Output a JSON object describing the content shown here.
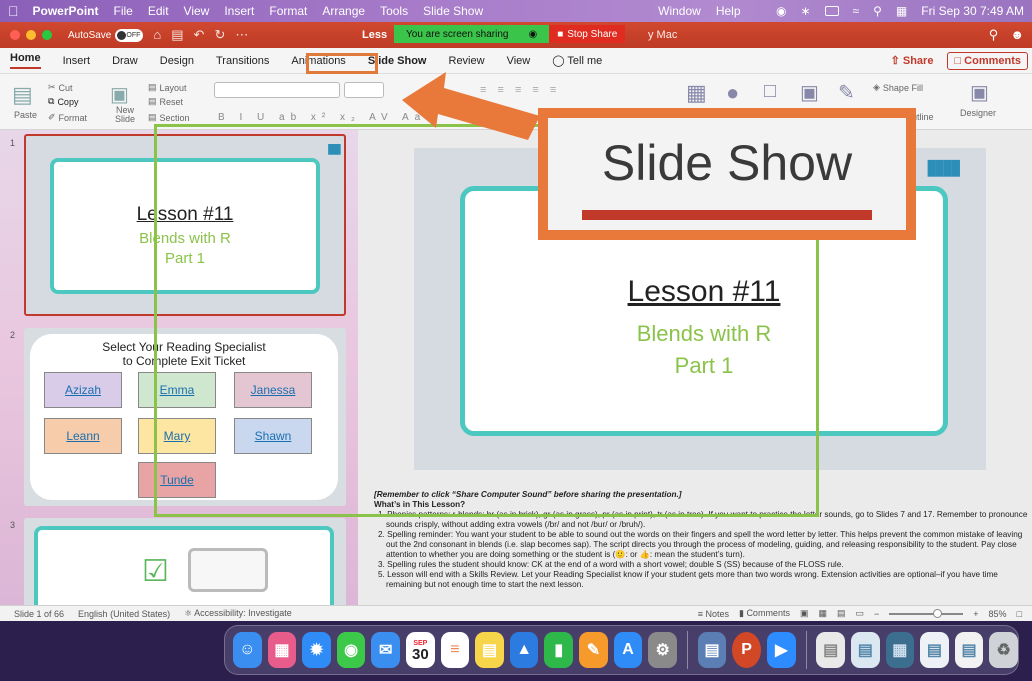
{
  "menubar": {
    "app_name": "PowerPoint",
    "items": [
      "File",
      "Edit",
      "View",
      "Insert",
      "Format",
      "Arrange",
      "Tools",
      "Slide Show"
    ],
    "window_item": "Window",
    "help_item": "Help",
    "datetime": "Fri Sep 30  7:49 AM"
  },
  "titlebar": {
    "autosave_label": "AutoSave",
    "autosave_state": "OFF",
    "doc_title": "Less",
    "sharing_text": "You are screen sharing",
    "stop_share": "Stop Share",
    "title_tail": "y Mac"
  },
  "tabs": {
    "items": [
      "Home",
      "Insert",
      "Draw",
      "Design",
      "Transitions",
      "Animations",
      "Slide Show",
      "Review",
      "View"
    ],
    "tell_me": "Tell me",
    "share": "Share",
    "comments": "Comments"
  },
  "ribbon": {
    "paste": "Paste",
    "cut": "Cut",
    "copy": "Copy",
    "format": "Format",
    "new_slide": "New Slide",
    "layout": "Layout",
    "reset": "Reset",
    "section": "Section",
    "shape_fill": "Shape Fill",
    "outline": "utline",
    "designer": "Designer"
  },
  "thumbnails": {
    "slide1": {
      "num": "1",
      "title": "Lesson #11",
      "line1": "Blends with R",
      "line2": "Part 1"
    },
    "slide2": {
      "num": "2",
      "heading1": "Select Your Reading Specialist",
      "heading2": "to Complete Exit Ticket",
      "names": [
        "Azizah",
        "Emma",
        "Janessa",
        "Leann",
        "Mary",
        "Shawn",
        "Tunde"
      ],
      "colors": [
        "#d9cce8",
        "#cfe6cf",
        "#e4c6d2",
        "#f6ccaa",
        "#fde6a2",
        "#cad8ef",
        "#e8a4a4"
      ]
    },
    "slide3": {
      "num": "3"
    }
  },
  "main_slide": {
    "title": "Lesson #11",
    "line1": "Blends with R",
    "line2": "Part 1"
  },
  "notes": {
    "reminder": "[Remember to click “Share Computer Sound” before sharing the presentation.]",
    "heading": "What’s in This Lesson?",
    "item1": "1. Phonics patterns: r-blends: br (as in brick), gr (as in grass), pr (as in print), tr (as in tree). If you want to practice the letter sounds, go to Slides 7 and 17. Remember to pronounce sounds crisply, without adding extra vowels (/br/ and not /bur/ or /bruh/).",
    "item2": "2. Spelling reminder: You want your student to be able to sound out the words on their fingers and spell the word letter by letter. This helps prevent the common mistake of leaving out the 2nd consonant in blends (i.e. slap becomes sap). The script directs you through the process of modeling, guiding, and releasing responsibility to the student. Pay close attention to whether you are doing something or the student is (🙂: or 👍: mean the student’s turn).",
    "item3": "3. Spelling rules the student should know: CK at the end of a word with a short vowel; double S (SS) because of the FLOSS rule.",
    "item5": "5. Lesson will end with a Skills Review. Let your Reading Specialist know if your student gets more than two words wrong. Extension activities are optional–if you have time remaining but not enough time to start the next lesson."
  },
  "status": {
    "slide_count": "Slide 1 of 66",
    "language": "English (United States)",
    "accessibility": "Accessibility: Investigate",
    "notes": "Notes",
    "comments": "Comments",
    "zoom": "85%"
  },
  "callout": {
    "text": "Slide Show"
  },
  "dock": {
    "calendar_month": "SEP",
    "calendar_day": "30",
    "apps": [
      {
        "name": "finder",
        "color": "#3a8ef0"
      },
      {
        "name": "launchpad",
        "color": "#e85c8c"
      },
      {
        "name": "safari",
        "color": "#2f8bf5"
      },
      {
        "name": "messages",
        "color": "#3cc94a"
      },
      {
        "name": "mail",
        "color": "#3a8ef0"
      },
      {
        "name": "calendar",
        "color": "#ffffff"
      },
      {
        "name": "reminders",
        "color": "#ffffff"
      },
      {
        "name": "notes",
        "color": "#f7d54a"
      },
      {
        "name": "keynote",
        "color": "#2b7be0"
      },
      {
        "name": "numbers",
        "color": "#2fb84a"
      },
      {
        "name": "pages",
        "color": "#f59a2b"
      },
      {
        "name": "app-store",
        "color": "#2f8bf5"
      },
      {
        "name": "system-preferences",
        "color": "#8a8a8a"
      },
      {
        "name": "preview",
        "color": "#5b7fb5"
      },
      {
        "name": "powerpoint",
        "color": "#d24726"
      },
      {
        "name": "zoom",
        "color": "#2d8cff"
      }
    ]
  }
}
